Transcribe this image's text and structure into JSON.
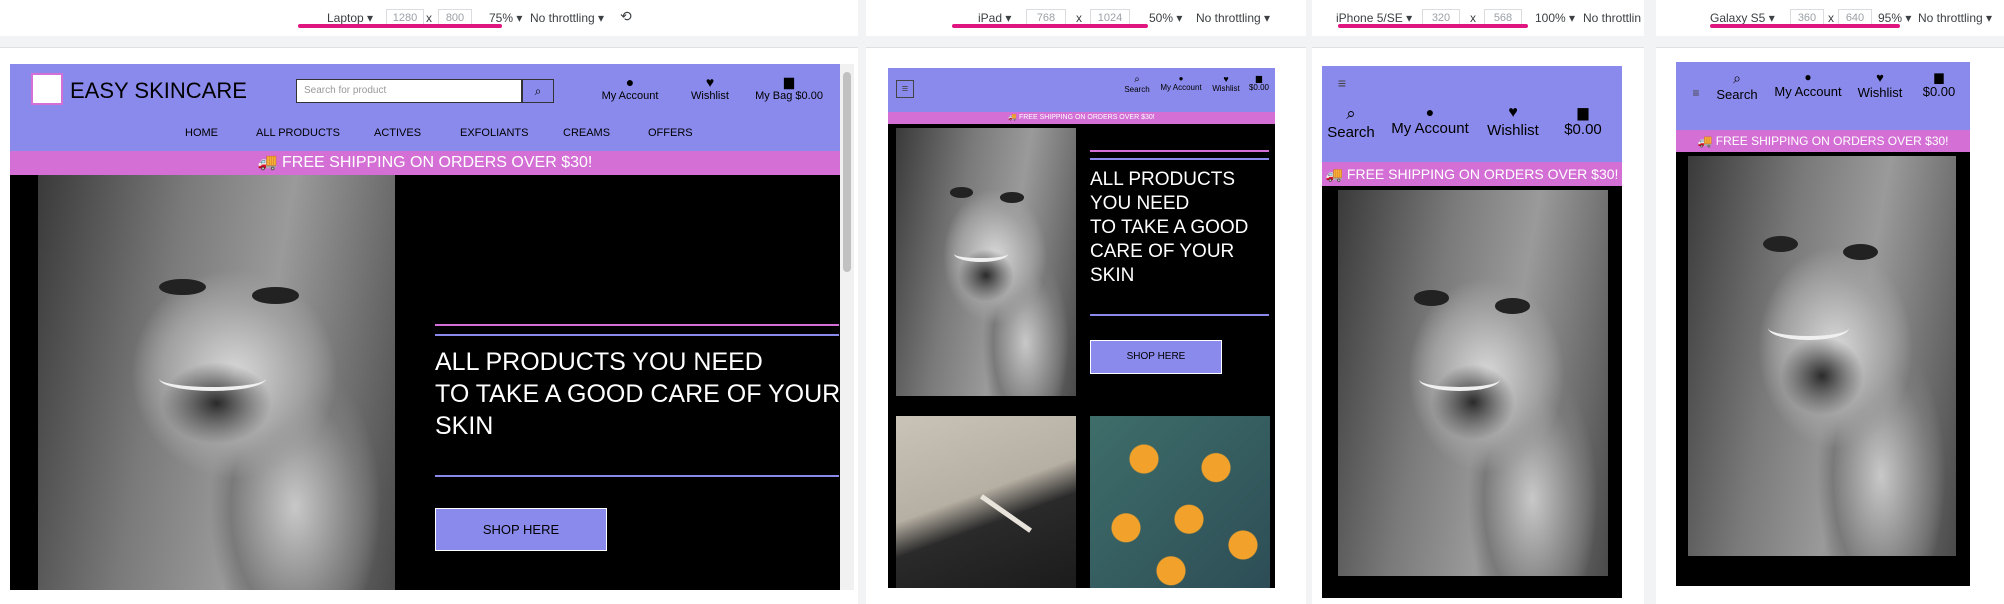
{
  "devices": [
    {
      "device": "Laptop",
      "width": "1280",
      "height": "800",
      "zoom": "75%",
      "throttle": "No throttling"
    },
    {
      "device": "iPad",
      "width": "768",
      "height": "1024",
      "zoom": "50%",
      "throttle": "No throttling"
    },
    {
      "device": "iPhone 5/SE",
      "width": "320",
      "height": "568",
      "zoom": "100%",
      "throttle": "No throttlin"
    },
    {
      "device": "Galaxy S5",
      "width": "360",
      "height": "640",
      "zoom": "95%",
      "throttle": "No throttling"
    }
  ],
  "toolbar": {
    "times": "x",
    "caret": "▾"
  },
  "site": {
    "brand": "EASY SKINCARE",
    "search_placeholder": "Search for product",
    "account": "My Account",
    "wishlist": "Wishlist",
    "bag": "My Bag $0.00",
    "bag_short": "$0.00",
    "search_label": "Search",
    "nav": [
      "HOME",
      "ALL PRODUCTS",
      "ACTIVES",
      "EXFOLIANTS",
      "CREAMS",
      "OFFERS"
    ],
    "shipping": "FREE SHIPPING ON ORDERS OVER $30!",
    "hero_line1": "ALL PRODUCTS YOU NEED",
    "hero_line2": "TO TAKE A GOOD CARE OF YOUR",
    "hero_line3": "SKIN",
    "tablet_hero": [
      "ALL PRODUCTS",
      "YOU NEED",
      "TO TAKE A GOOD",
      "CARE OF YOUR",
      "SKIN"
    ],
    "shop_button": "SHOP HERE"
  },
  "colors": {
    "nav": "#8a8aec",
    "ship": "#d36fd5",
    "accent": "#e0157f"
  }
}
